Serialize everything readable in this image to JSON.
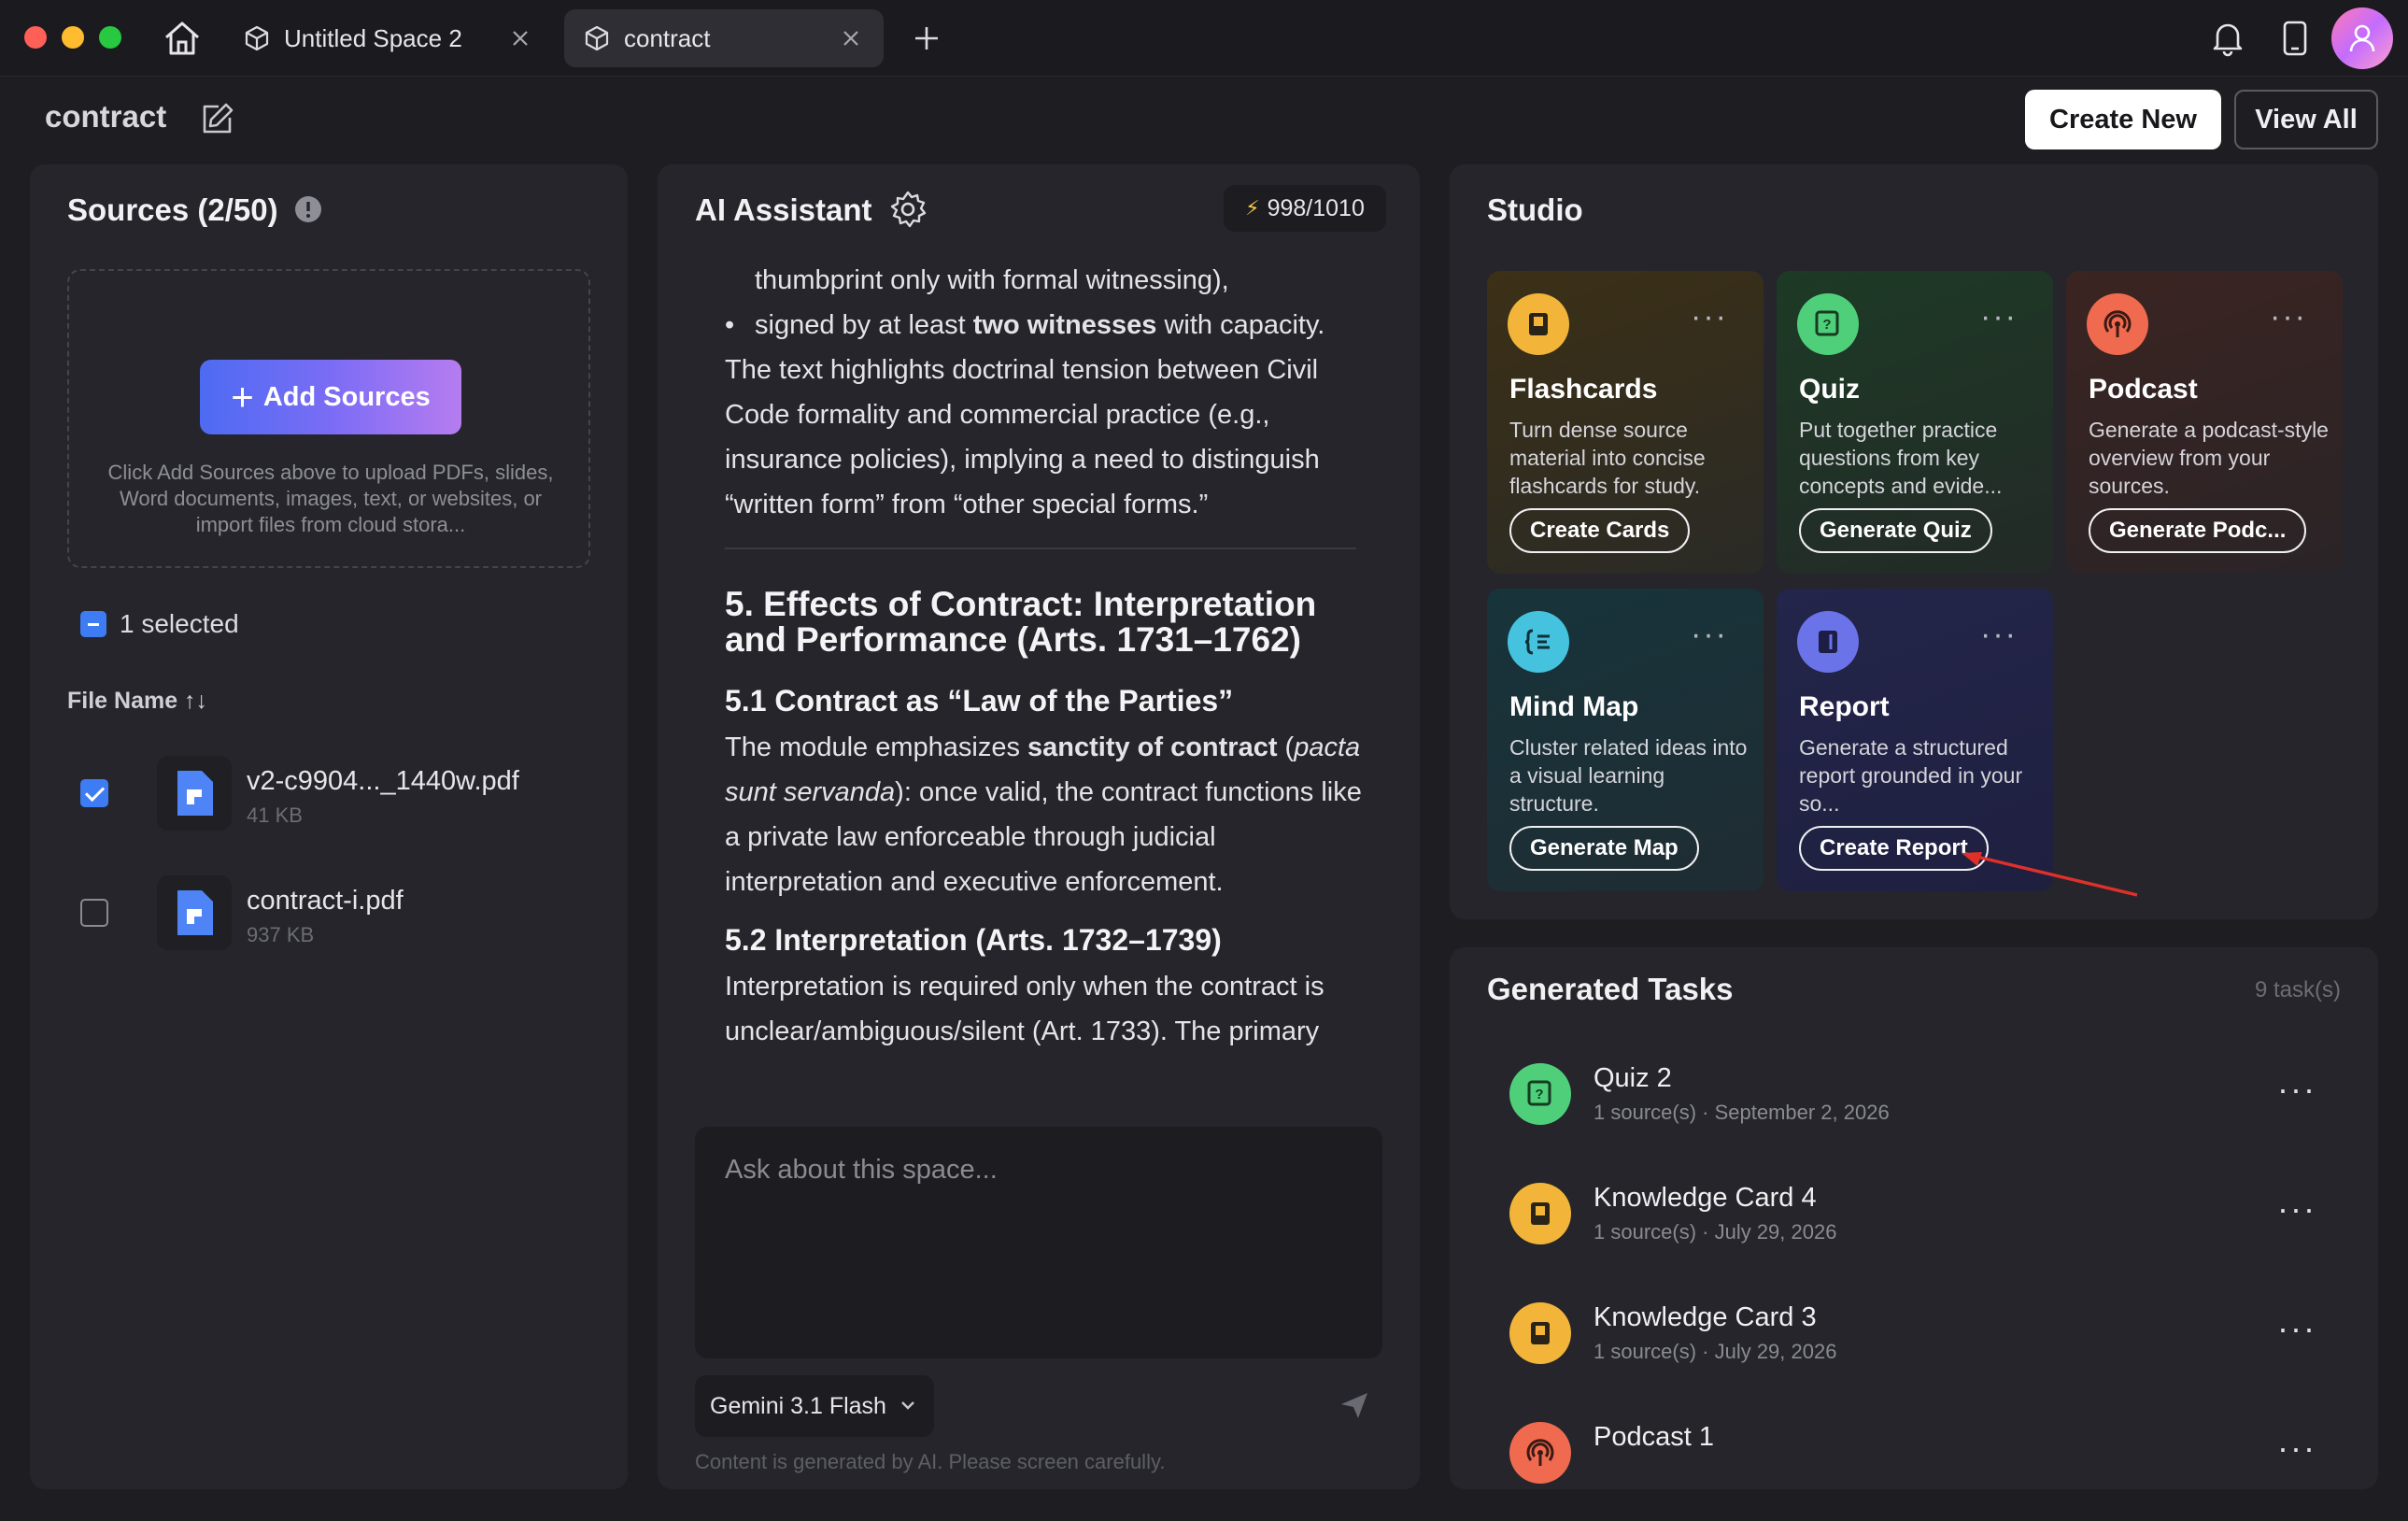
{
  "tabs": [
    {
      "label": "Untitled Space 2"
    },
    {
      "label": "contract"
    }
  ],
  "header": {
    "space_title": "contract",
    "create_new_label": "Create New",
    "view_all_label": "View All"
  },
  "sources": {
    "title": "Sources (2/50)",
    "add_label": "Add Sources",
    "hint": "Click Add Sources above to upload PDFs, slides, Word documents, images, text, or websites, or import files from cloud stora...",
    "selected_text": "1 selected",
    "file_header": "File Name ↑↓",
    "files": [
      {
        "name": "v2-c9904..._1440w.pdf",
        "size": "41 KB",
        "checked": true
      },
      {
        "name": "contract-i.pdf",
        "size": "937 KB",
        "checked": false
      }
    ]
  },
  "ai": {
    "title": "AI Assistant",
    "credits": "998/1010",
    "line1": "thumbprint only with formal witnessing),",
    "bullet_pre": "signed by at least ",
    "bullet_bold": "two witnesses",
    "bullet_post": " with capacity.",
    "para1": "The text highlights doctrinal tension between Civil Code formality and commercial practice (e.g., insurance policies), implying a need to distinguish “written form” from “other special forms.”",
    "h2": "5. Effects of Contract: Interpretation and Performance (Arts. 1731–1762)",
    "h3a": "5.1 Contract as “Law of the Parties”",
    "p2_pre": "The module emphasizes ",
    "p2_bold": "sanctity of contract",
    "p2_mid1": " (",
    "p2_italic": "pacta sunt servanda",
    "p2_post": "): once valid, the contract functions like a private law enforceable through judicial interpretation and executive enforcement.",
    "h3b": "5.2 Interpretation (Arts. 1732–1739)",
    "p3": "Interpretation is required only when the contract is unclear/ambiguous/silent (Art. 1733). The primary",
    "ask_placeholder": "Ask about this space...",
    "model": "Gemini 3.1 Flash",
    "disclaimer": "Content is generated by AI. Please screen carefully."
  },
  "studio": {
    "title": "Studio",
    "cards": [
      {
        "title": "Flashcards",
        "desc": "Turn dense source material into concise flashcards for study.",
        "button": "Create Cards",
        "icon": "flashcard-icon",
        "color": "#f2b53a"
      },
      {
        "title": "Quiz",
        "desc": "Put together practice questions from key concepts and evide...",
        "button": "Generate Quiz",
        "icon": "quiz-icon",
        "color": "#4fcf7a"
      },
      {
        "title": "Podcast",
        "desc": "Generate a podcast-style overview from your sources.",
        "button": "Generate Podc...",
        "icon": "podcast-icon",
        "color": "#f06a4f"
      },
      {
        "title": "Mind Map",
        "desc": "Cluster related ideas into a visual learning structure.",
        "button": "Generate Map",
        "icon": "mind-map-icon",
        "color": "#45c2de"
      },
      {
        "title": "Report",
        "desc": "Generate a structured report grounded in your so...",
        "button": "Create Report",
        "icon": "report-icon",
        "color": "#6a73e8"
      }
    ]
  },
  "tasks": {
    "title": "Generated Tasks",
    "count": "9 task(s)",
    "items": [
      {
        "name": "Quiz 2",
        "meta": "1 source(s) · September 2, 2026",
        "icon": "quiz-icon"
      },
      {
        "name": "Knowledge Card 4",
        "meta": "1 source(s) · July 29, 2026",
        "icon": "flashcard-icon"
      },
      {
        "name": "Knowledge Card 3",
        "meta": "1 source(s) · July 29, 2026",
        "icon": "flashcard-icon"
      },
      {
        "name": "Podcast 1",
        "meta": "",
        "icon": "podcast-icon"
      }
    ]
  }
}
